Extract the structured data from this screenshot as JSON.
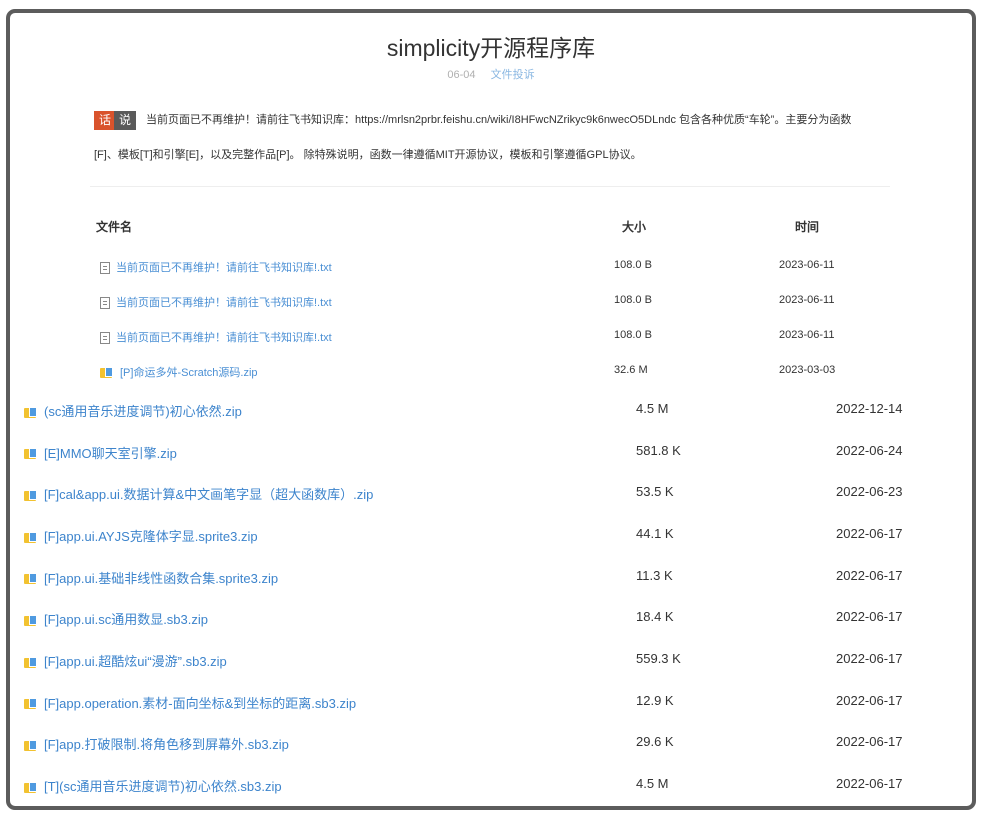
{
  "page": {
    "title": "simplicity开源程序库",
    "date": "06-04",
    "report_link": "文件投诉"
  },
  "notice": {
    "tag_left": "话",
    "tag_right": "说",
    "text_line1": "当前页面已不再维护！请前往飞书知识库：https://mrlsn2prbr.feishu.cn/wiki/I8HFwcNZrikyc9k6nwecO5DLndc 包含各种优质“车轮”。主要分为函数",
    "text_line2": "[F]、模板[T]和引擎[E]，以及完整作品[P]。 除特殊说明，函数一律遵循MIT开源协议，模板和引擎遵循GPL协议。"
  },
  "table": {
    "headers": {
      "name": "文件名",
      "size": "大小",
      "time": "时间"
    },
    "rows": [
      {
        "icon": "text-file-icon",
        "name": "当前页面已不再维护！请前往飞书知识库!.txt",
        "size": "108.0 B",
        "time": "2023-06-11"
      },
      {
        "icon": "text-file-icon",
        "name": "当前页面已不再维护！请前往飞书知识库!.txt",
        "size": "108.0 B",
        "time": "2023-06-11"
      },
      {
        "icon": "text-file-icon",
        "name": "当前页面已不再维护！请前往飞书知识库!.txt",
        "size": "108.0 B",
        "time": "2023-06-11"
      },
      {
        "icon": "zip-file-icon",
        "name": "[P]命运多舛-Scratch源码.zip",
        "size": "32.6 M",
        "time": "2023-03-03"
      },
      {
        "icon": "zip-file-icon",
        "name": "(sc通用音乐进度调节)初心依然.zip",
        "size": "4.5 M",
        "time": "2022-12-14"
      },
      {
        "icon": "zip-file-icon",
        "name": "[E]MMO聊天室引擎.zip",
        "size": "581.8 K",
        "time": "2022-06-24"
      },
      {
        "icon": "zip-file-icon",
        "name": "[F]cal&app.ui.数据计算&中文画笔字显（超大函数库）.zip",
        "size": "53.5 K",
        "time": "2022-06-23"
      },
      {
        "icon": "zip-file-icon",
        "name": "[F]app.ui.AYJS克隆体字显.sprite3.zip",
        "size": "44.1 K",
        "time": "2022-06-17"
      },
      {
        "icon": "zip-file-icon",
        "name": "[F]app.ui.基础非线性函数合集.sprite3.zip",
        "size": "11.3 K",
        "time": "2022-06-17"
      },
      {
        "icon": "zip-file-icon",
        "name": "[F]app.ui.sc通用数显.sb3.zip",
        "size": "18.4 K",
        "time": "2022-06-17"
      },
      {
        "icon": "zip-file-icon",
        "name": "[F]app.ui.超酷炫ui“漫游”.sb3.zip",
        "size": "559.3 K",
        "time": "2022-06-17"
      },
      {
        "icon": "zip-file-icon",
        "name": "[F]app.operation.素材-面向坐标&到坐标的距离.sb3.zip",
        "size": "12.9 K",
        "time": "2022-06-17"
      },
      {
        "icon": "zip-file-icon",
        "name": "[F]app.打破限制.将角色移到屏幕外.sb3.zip",
        "size": "29.6 K",
        "time": "2022-06-17"
      },
      {
        "icon": "zip-file-icon",
        "name": "[T](sc通用音乐进度调节)初心依然.sb3.zip",
        "size": "4.5 M",
        "time": "2022-06-17"
      }
    ]
  }
}
